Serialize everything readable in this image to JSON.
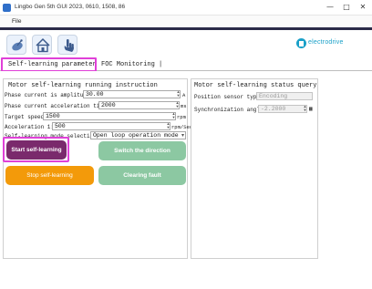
{
  "window": {
    "title": "Lingbo Gen 5th GUI 2023, 0610, 1508, 86",
    "minimize": "—",
    "maximize": "□",
    "close": "✕"
  },
  "menu": {
    "file": "File"
  },
  "toolbar": {
    "buttons": [
      {
        "icon": "satellite-icon"
      },
      {
        "icon": "home-icon"
      },
      {
        "icon": "hand-pointer-icon"
      }
    ],
    "logo_text": "electrodrive",
    "accent": "#1aa0c8"
  },
  "tabs": [
    {
      "label": "Self-learning parameter",
      "active": true
    },
    {
      "label": "FOC Monitoring |",
      "active": false
    }
  ],
  "left_panel": {
    "title": "Motor  self-learning running instruction",
    "fields": {
      "phase_current_amplitude": {
        "label": "Phase current is amplitude:",
        "value": "30.00",
        "unit": "A"
      },
      "phase_current_accel": {
        "label": "Phase current acceleration time:",
        "value": "2000",
        "unit": "ms"
      },
      "target_speed": {
        "label": "Target speed:",
        "value": "1500",
        "unit": "rpm"
      },
      "acceleration": {
        "label": "Acceleration 1:",
        "value": "500",
        "unit": "rpm/Sec"
      },
      "mode": {
        "label": "Self-learning mode selection:",
        "value": "Open loop operation mode"
      }
    },
    "buttons": {
      "start": "Start self-learning",
      "switch": "Switch the direction",
      "stop": "Stop self-learning",
      "clear": "Clearing fault"
    }
  },
  "right_panel": {
    "title": "Motor self-learning status query",
    "fields": {
      "sensor_type": {
        "label": "Position sensor type:",
        "value": "Encoding"
      },
      "sync_angle": {
        "label": "Synchronization angle:",
        "value": "-2.2000"
      }
    }
  },
  "colors": {
    "highlight": "#e040d8",
    "start_button": "#7a2a6c",
    "green_button": "#8cc8a2",
    "stop_button": "#f39a0a"
  }
}
